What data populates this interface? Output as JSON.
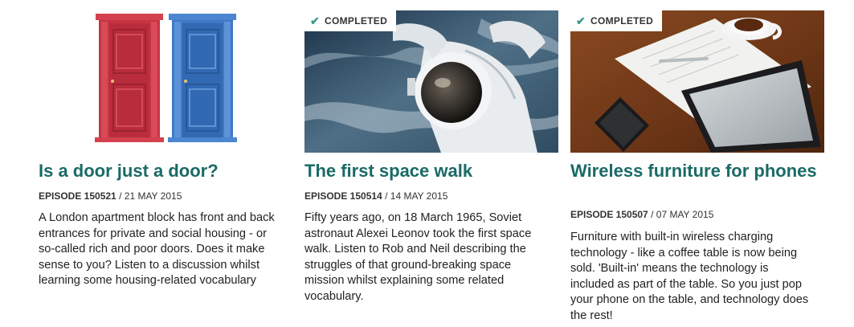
{
  "completed_label": "COMPLETED",
  "episodes": [
    {
      "title": "Is a door just a door?",
      "episode_label": "EPISODE 150521",
      "date": "21 MAY 2015",
      "description": "A London apartment block has front and back entrances for private and social housing - or so-called rich and poor doors. Does it make sense to you? Listen to a discussion whilst learning some housing-related vocabulary",
      "image": "red-and-blue-doors"
    },
    {
      "title": "The first space walk",
      "episode_label": "EPISODE 150514",
      "date": "14 MAY 2015",
      "description": "Fifty years ago, on 18 March 1965, Soviet astronaut Alexei Leonov took the first space walk. Listen to Rob and Neil describing the struggles of that ground-breaking space mission whilst explaining some related vocabulary.",
      "image": "astronaut-spacewalk",
      "completed": true
    },
    {
      "title": "Wireless furniture for phones",
      "episode_label": "EPISODE 150507",
      "date": "07 MAY 2015",
      "description": "Furniture with built-in wireless charging technology - like a coffee table is now being sold. 'Built-in' means the technology is included as part of the table. So you just pop your phone on the table, and technology does the rest!",
      "image": "tablet-phone-coffee-table",
      "completed": true
    }
  ],
  "colors": {
    "title": "#1a6a66",
    "check": "#3a9a8c"
  }
}
